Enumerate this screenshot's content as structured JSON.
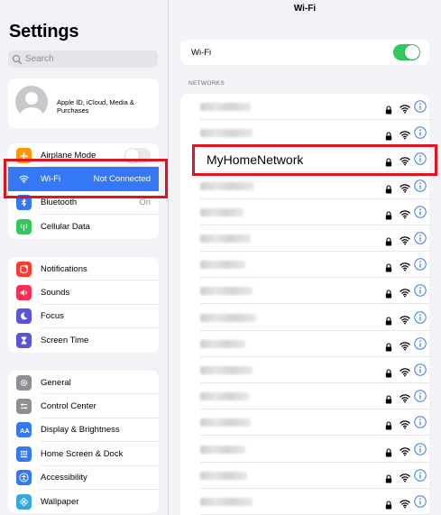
{
  "sidebar": {
    "title": "Settings",
    "search_placeholder": "Search",
    "account_label": "Apple ID, iCloud, Media & Purchases",
    "group1": [
      {
        "label": "Airplane Mode",
        "value": "",
        "icon": "airplane-icon",
        "color": "#ff9500"
      },
      {
        "label": "Wi-Fi",
        "value": "Not Connected",
        "icon": "wifi-icon",
        "color": "#3478f6"
      },
      {
        "label": "Bluetooth",
        "value": "On",
        "icon": "bluetooth-icon",
        "color": "#3478f6"
      },
      {
        "label": "Cellular Data",
        "value": "",
        "icon": "antenna-icon",
        "color": "#34c759"
      }
    ],
    "group2": [
      {
        "label": "Notifications",
        "icon": "bell-icon",
        "color": "#ff3b30"
      },
      {
        "label": "Sounds",
        "icon": "speaker-icon",
        "color": "#ff2d55"
      },
      {
        "label": "Focus",
        "icon": "moon-icon",
        "color": "#5856d6"
      },
      {
        "label": "Screen Time",
        "icon": "hourglass-icon",
        "color": "#5856d6"
      }
    ],
    "group3": [
      {
        "label": "General",
        "icon": "gear-icon",
        "color": "#8e8e93"
      },
      {
        "label": "Control Center",
        "icon": "sliders-icon",
        "color": "#8e8e93"
      },
      {
        "label": "Display & Brightness",
        "icon": "text-size-icon",
        "color": "#3478f6"
      },
      {
        "label": "Home Screen & Dock",
        "icon": "grid-icon",
        "color": "#3478f6"
      },
      {
        "label": "Accessibility",
        "icon": "accessibility-icon",
        "color": "#3478f6"
      },
      {
        "label": "Wallpaper",
        "icon": "flower-icon",
        "color": "#34aadc"
      }
    ]
  },
  "detail": {
    "title": "Wi-Fi",
    "wifi_label": "Wi-Fi",
    "wifi_on": true,
    "networks_header": "NETWORKS",
    "highlighted_network": "MyHomeNetwork"
  },
  "colors": {
    "accent": "#3478f6",
    "toggle_on": "#34c759",
    "highlight": "#e0141e"
  }
}
